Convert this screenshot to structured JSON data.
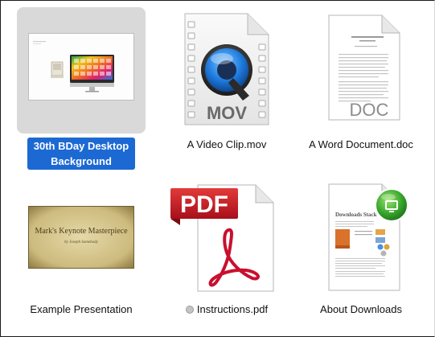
{
  "finder": {
    "files": [
      {
        "name": "30th BDay Desktop Background",
        "line1": "30th BDay Desktop",
        "line2": "Background",
        "kind": "image",
        "selected": true
      },
      {
        "name": "A Video Clip.mov",
        "kind": "movie",
        "badge": "MOV"
      },
      {
        "name": "A Word Document.doc",
        "kind": "document",
        "badge": "DOC"
      },
      {
        "name": "Example Presentation",
        "kind": "presentation",
        "slide_title": "Mark's Keynote Masterpiece",
        "slide_subtitle": "by Joseph Somebody"
      },
      {
        "name": "Instructions.pdf",
        "kind": "pdf",
        "badge": "PDF",
        "status": "grey-tag-dot"
      },
      {
        "name": "About Downloads",
        "kind": "document",
        "doc_title": "Downloads Stack"
      }
    ]
  },
  "colors": {
    "selection_highlight": "#1c69d4",
    "selection_background": "#d9d9d9",
    "pdf_red": "#c8102e"
  }
}
